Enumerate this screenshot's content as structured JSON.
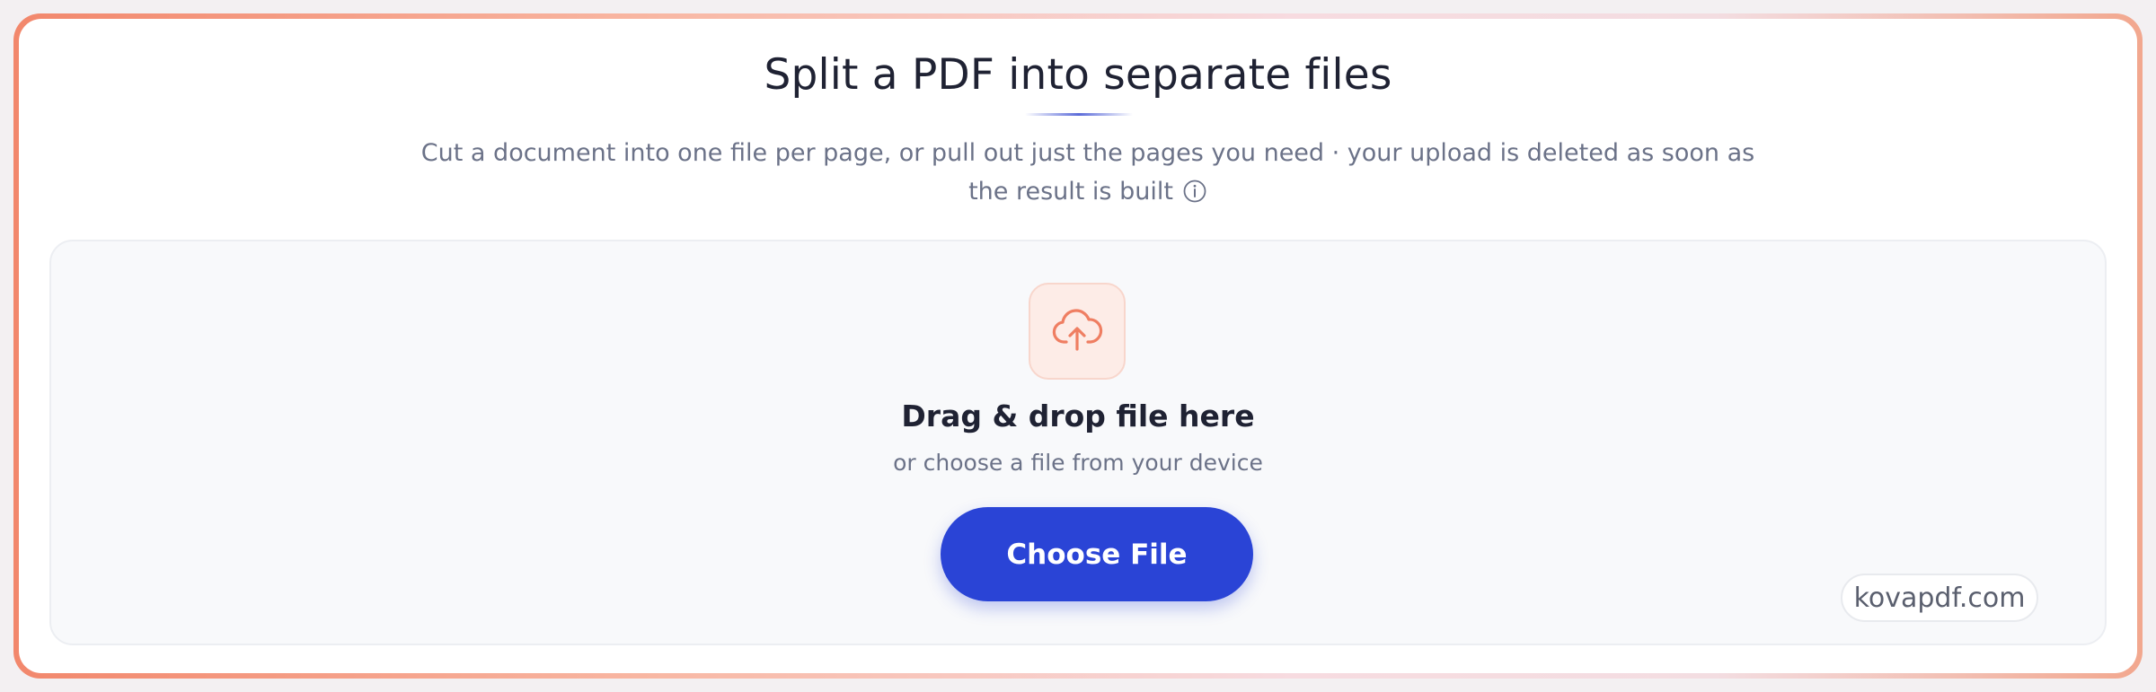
{
  "page": {
    "title": "Split a PDF into separate files",
    "subtitle": "Cut a document into one file per page, or pull out just the pages you need · your upload is deleted as soon as the result is built",
    "info_icon": "info-circle-icon"
  },
  "dropzone": {
    "icon": "cloud-upload-icon",
    "heading": "Drag & drop file here",
    "subheading": "or choose a file from your device",
    "button_label": "Choose File"
  },
  "watermark": {
    "text": "kovapdf.com"
  },
  "colors": {
    "accent_blue": "#2a44d6",
    "accent_coral": "#f2876c",
    "text_dark": "#1f2233",
    "text_muted": "#6b7288"
  }
}
